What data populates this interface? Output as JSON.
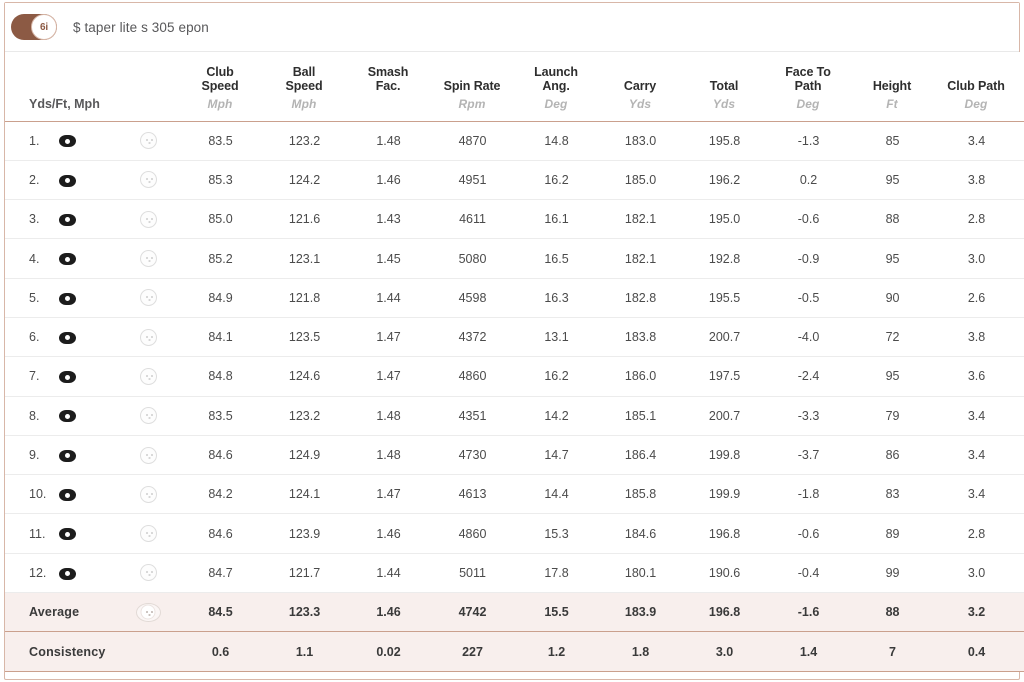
{
  "session": {
    "club_badge": "6i",
    "title": "$ taper lite s 305 epon",
    "units_label": "Yds/Ft, Mph",
    "accent_color": "#8c5a44",
    "border_color": "#caa08d",
    "summary_bg": "#f8efed"
  },
  "icons": {
    "eye": "eye-icon",
    "ball": "golf-ball-icon"
  },
  "columns": [
    {
      "name": "Club Speed",
      "line1": "Club",
      "line2": "Speed",
      "unit": "Mph"
    },
    {
      "name": "Ball Speed",
      "line1": "Ball",
      "line2": "Speed",
      "unit": "Mph"
    },
    {
      "name": "Smash Fac.",
      "line1": "Smash",
      "line2": "Fac.",
      "unit": ""
    },
    {
      "name": "Spin Rate",
      "line1": "Spin Rate",
      "line2": "",
      "unit": "Rpm"
    },
    {
      "name": "Launch Ang.",
      "line1": "Launch",
      "line2": "Ang.",
      "unit": "Deg"
    },
    {
      "name": "Carry",
      "line1": "Carry",
      "line2": "",
      "unit": "Yds"
    },
    {
      "name": "Total",
      "line1": "Total",
      "line2": "",
      "unit": "Yds"
    },
    {
      "name": "Face To Path",
      "line1": "Face To",
      "line2": "Path",
      "unit": "Deg"
    },
    {
      "name": "Height",
      "line1": "Height",
      "line2": "",
      "unit": "Ft"
    },
    {
      "name": "Club Path",
      "line1": "Club Path",
      "line2": "",
      "unit": "Deg"
    }
  ],
  "rows": [
    {
      "num": "1.",
      "values": [
        "83.5",
        "123.2",
        "1.48",
        "4870",
        "14.8",
        "183.0",
        "195.8",
        "-1.3",
        "85",
        "3.4"
      ]
    },
    {
      "num": "2.",
      "values": [
        "85.3",
        "124.2",
        "1.46",
        "4951",
        "16.2",
        "185.0",
        "196.2",
        "0.2",
        "95",
        "3.8"
      ]
    },
    {
      "num": "3.",
      "values": [
        "85.0",
        "121.6",
        "1.43",
        "4611",
        "16.1",
        "182.1",
        "195.0",
        "-0.6",
        "88",
        "2.8"
      ]
    },
    {
      "num": "4.",
      "values": [
        "85.2",
        "123.1",
        "1.45",
        "5080",
        "16.5",
        "182.1",
        "192.8",
        "-0.9",
        "95",
        "3.0"
      ]
    },
    {
      "num": "5.",
      "values": [
        "84.9",
        "121.8",
        "1.44",
        "4598",
        "16.3",
        "182.8",
        "195.5",
        "-0.5",
        "90",
        "2.6"
      ]
    },
    {
      "num": "6.",
      "values": [
        "84.1",
        "123.5",
        "1.47",
        "4372",
        "13.1",
        "183.8",
        "200.7",
        "-4.0",
        "72",
        "3.8"
      ]
    },
    {
      "num": "7.",
      "values": [
        "84.8",
        "124.6",
        "1.47",
        "4860",
        "16.2",
        "186.0",
        "197.5",
        "-2.4",
        "95",
        "3.6"
      ]
    },
    {
      "num": "8.",
      "values": [
        "83.5",
        "123.2",
        "1.48",
        "4351",
        "14.2",
        "185.1",
        "200.7",
        "-3.3",
        "79",
        "3.4"
      ]
    },
    {
      "num": "9.",
      "values": [
        "84.6",
        "124.9",
        "1.48",
        "4730",
        "14.7",
        "186.4",
        "199.8",
        "-3.7",
        "86",
        "3.4"
      ]
    },
    {
      "num": "10.",
      "values": [
        "84.2",
        "124.1",
        "1.47",
        "4613",
        "14.4",
        "185.8",
        "199.9",
        "-1.8",
        "83",
        "3.4"
      ]
    },
    {
      "num": "11.",
      "values": [
        "84.6",
        "123.9",
        "1.46",
        "4860",
        "15.3",
        "184.6",
        "196.8",
        "-0.6",
        "89",
        "2.8"
      ]
    },
    {
      "num": "12.",
      "values": [
        "84.7",
        "121.7",
        "1.44",
        "5011",
        "17.8",
        "180.1",
        "190.6",
        "-0.4",
        "99",
        "3.0"
      ]
    }
  ],
  "summary": {
    "average": {
      "label": "Average",
      "values": [
        "84.5",
        "123.3",
        "1.46",
        "4742",
        "15.5",
        "183.9",
        "196.8",
        "-1.6",
        "88",
        "3.2"
      ]
    },
    "consistency": {
      "label": "Consistency",
      "values": [
        "0.6",
        "1.1",
        "0.02",
        "227",
        "1.2",
        "1.8",
        "3.0",
        "1.4",
        "7",
        "0.4"
      ]
    }
  }
}
